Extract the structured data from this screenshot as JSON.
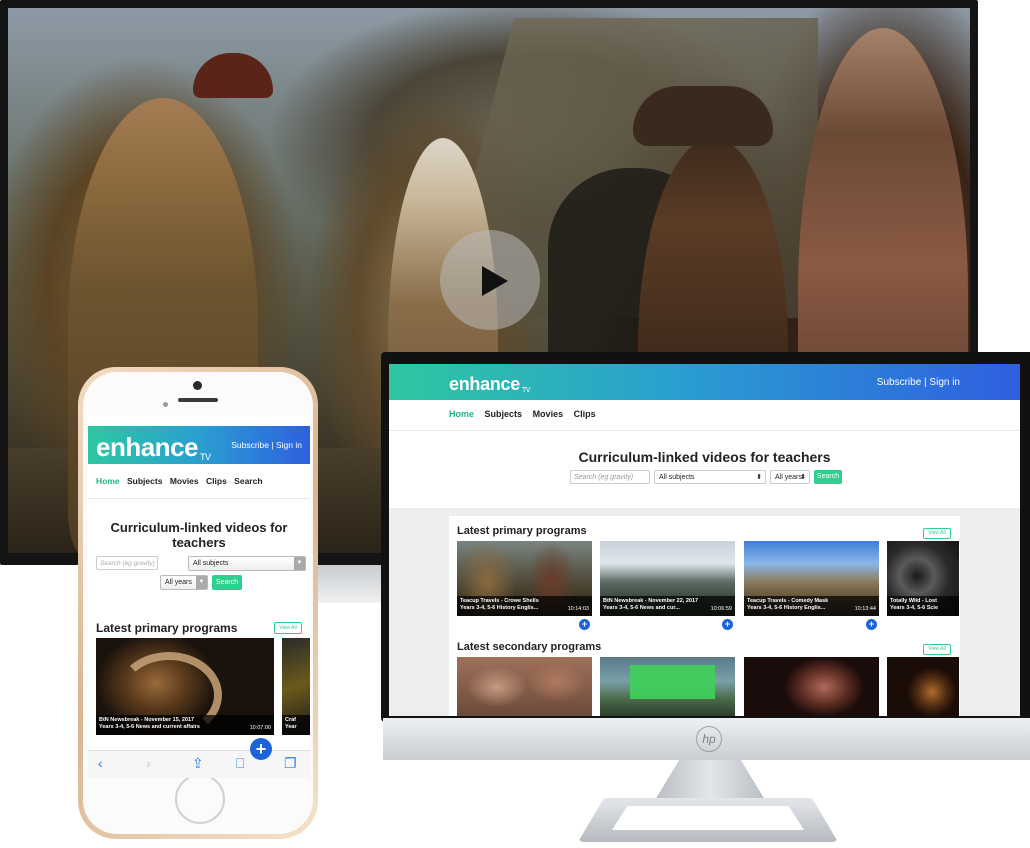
{
  "tv": {
    "play_icon": "play-icon"
  },
  "monitor": {
    "logo": "enhance",
    "logo_sub": "TV",
    "subscribe": "Subscribe",
    "separator": "|",
    "signin": "Sign in",
    "nav": [
      "Home",
      "Subjects",
      "Movies",
      "Clips"
    ],
    "title": "Curriculum-linked videos for teachers",
    "search_placeholder": "Search (eg gravity)",
    "subjects_select": "All subjects",
    "years_select": "All years",
    "search_button": "Search",
    "sections": [
      {
        "title": "Latest primary programs",
        "view_all": "View All",
        "items": [
          {
            "title": "Teacup Travels - Crowe Shells",
            "meta": "Years 3-4, 5-6 History Englis...",
            "duration": "10:14:03"
          },
          {
            "title": "BtN Newsbreak - November 22, 2017",
            "meta": "Years 3-4, 5-6 News and cur...",
            "duration": "10:06:59"
          },
          {
            "title": "Teacup Travels - Comedy Mask",
            "meta": "Years 3-4, 5-6 History Englis...",
            "duration": "10:13:44"
          },
          {
            "title": "Totally Wild - Lost",
            "meta": "Years 3-4, 5-6 Scie",
            "duration": ""
          }
        ]
      },
      {
        "title": "Latest secondary programs",
        "view_all": "View All",
        "items": []
      }
    ]
  },
  "phone": {
    "logo": "enhance",
    "logo_sub": "TV",
    "subscribe": "Subscribe",
    "separator": "|",
    "signin": "Sign in",
    "nav": [
      "Home",
      "Subjects",
      "Movies",
      "Clips",
      "Search"
    ],
    "title": "Curriculum-linked videos for teachers",
    "search_placeholder": "Search (eg gravity)",
    "subjects_select": "All subjects",
    "years_select": "All years",
    "search_button": "Search",
    "section_title": "Latest primary programs",
    "view_all": "View All",
    "item": {
      "title": "BtN Newsbreak - November 15, 2017",
      "meta": "Years 3-4, 5-6 News and current affairs",
      "duration": "10:07:00"
    },
    "item2": {
      "title": "Craf",
      "meta": "Year"
    },
    "toolbar": {
      "back": "‹",
      "forward": "›",
      "share": "⇪",
      "bookmarks": "⎕",
      "tabs": "❐"
    }
  }
}
